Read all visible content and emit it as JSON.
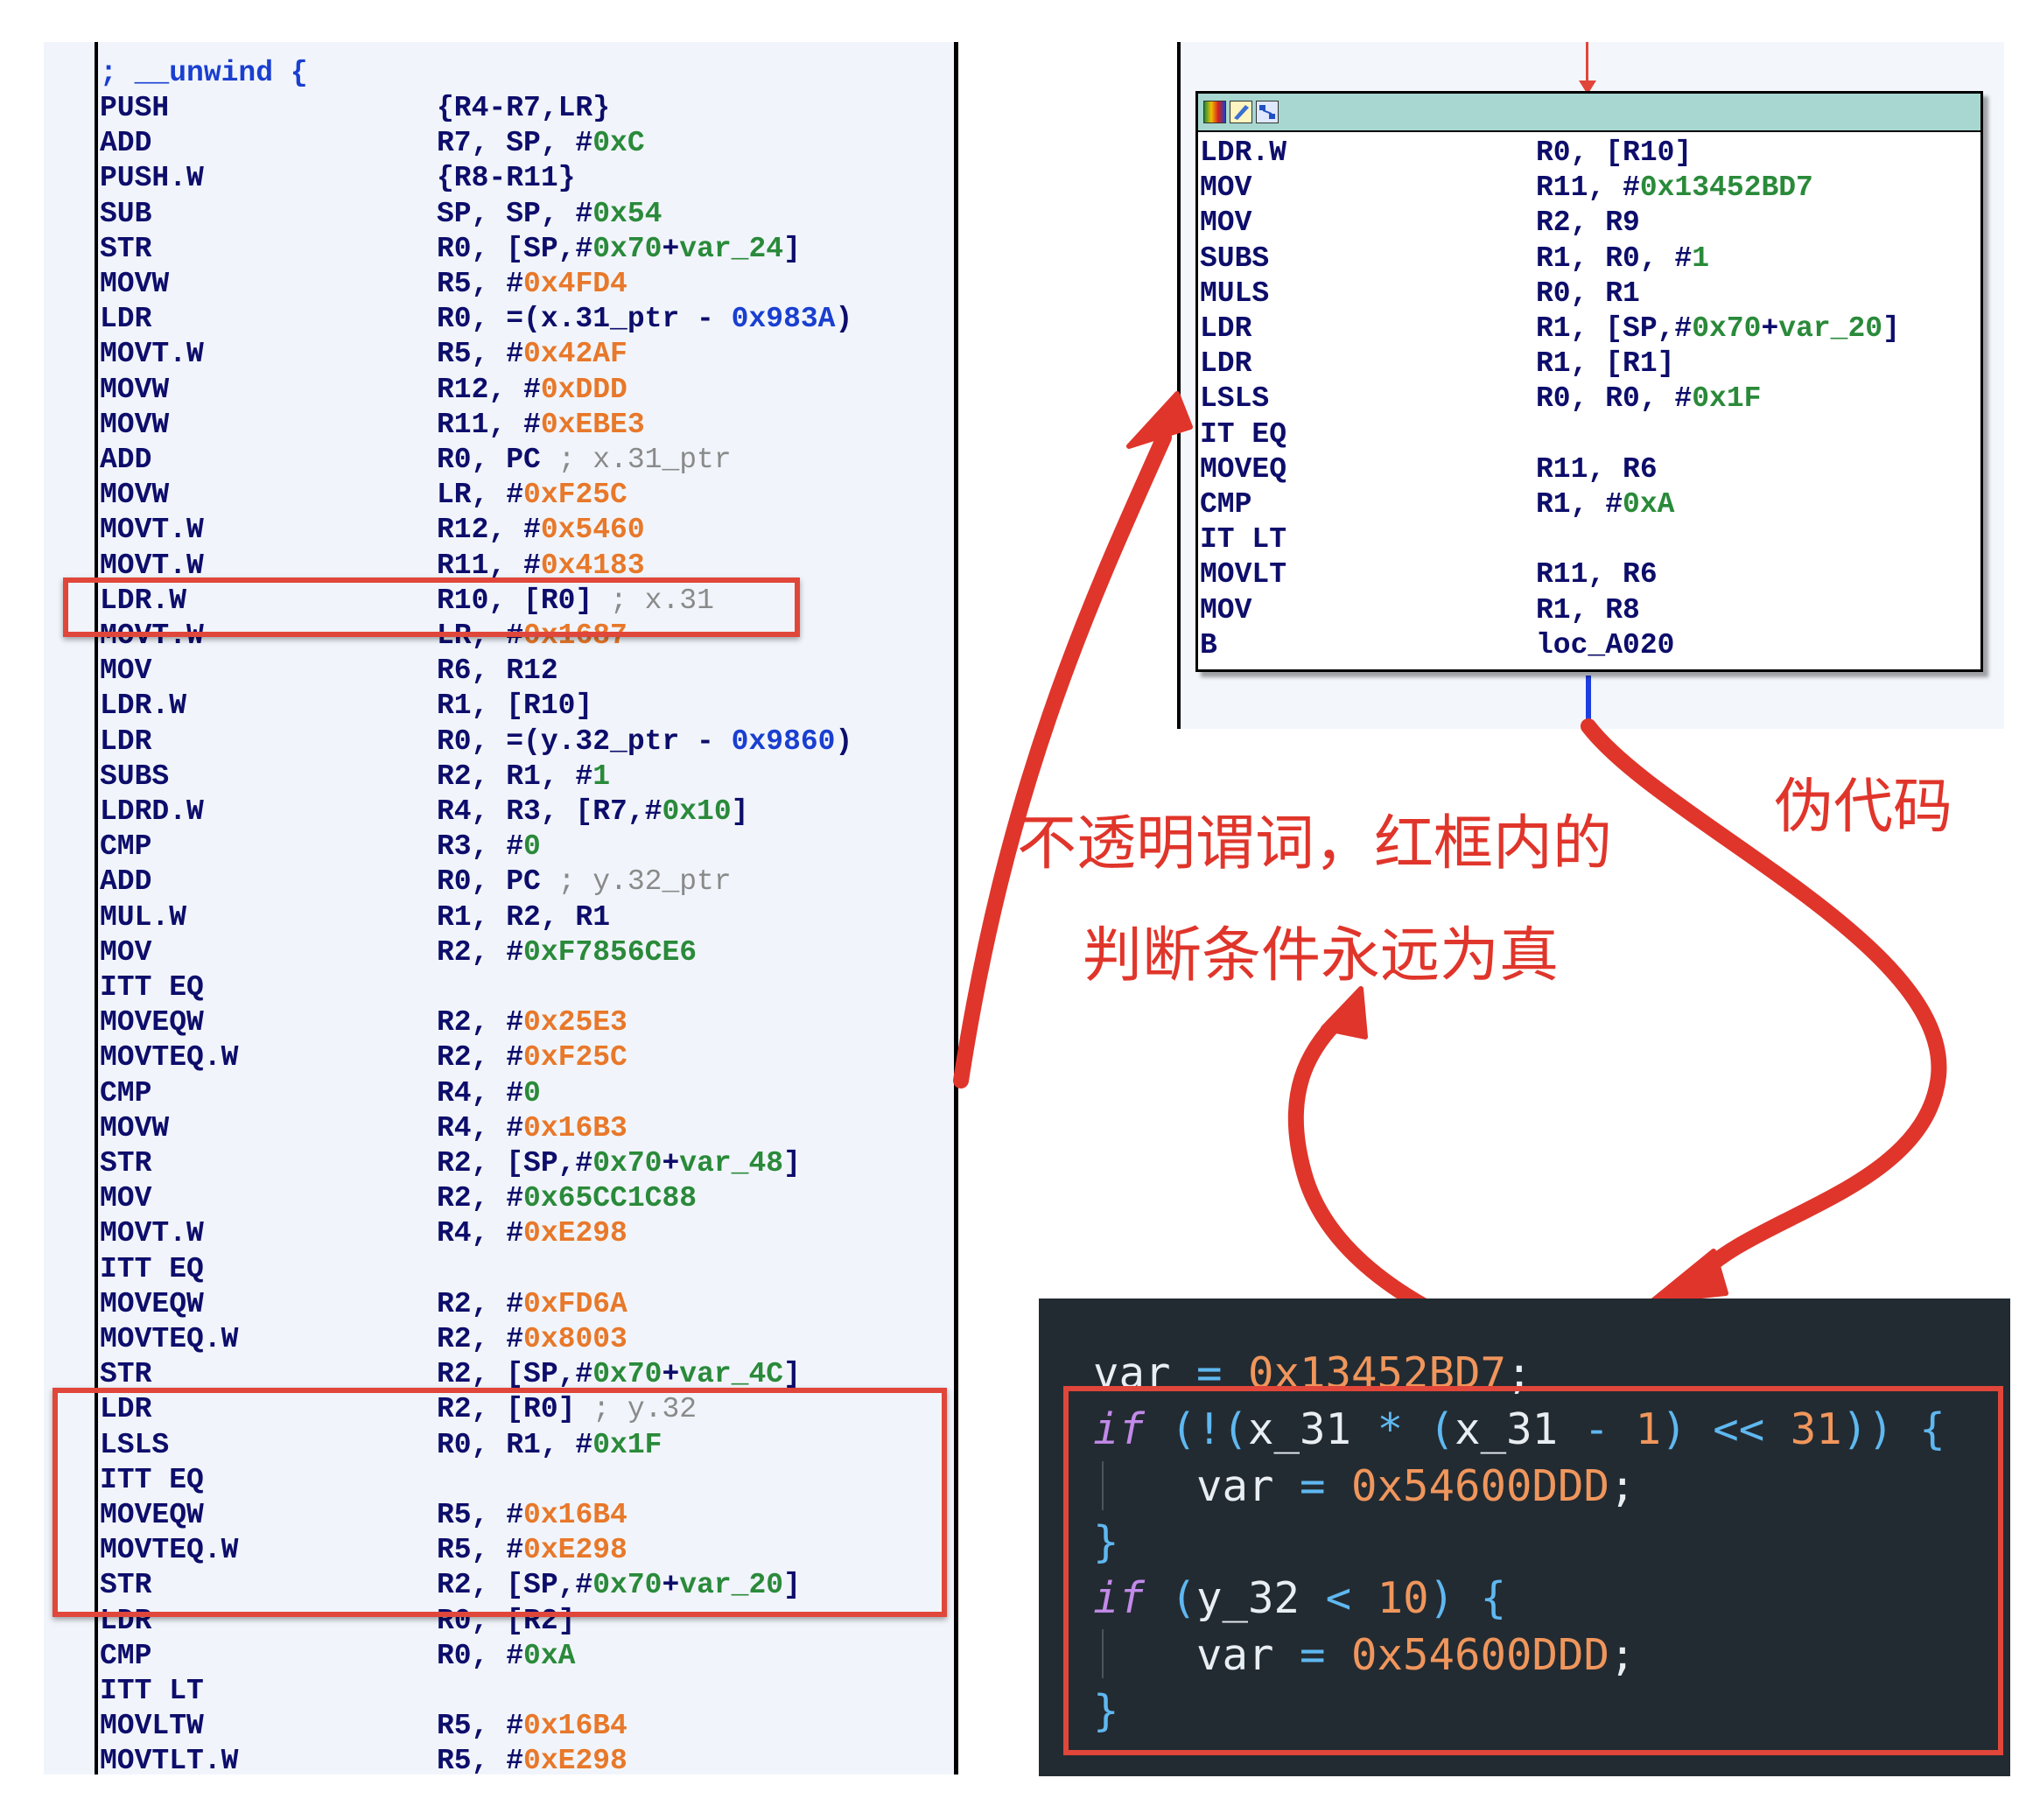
{
  "left_listing": {
    "header": "; __unwind {",
    "rows": [
      {
        "mn": "PUSH",
        "op": [
          {
            "t": "{R4-R7,LR}"
          }
        ]
      },
      {
        "mn": "ADD",
        "op": [
          {
            "t": "R7, SP, #"
          },
          {
            "t": "0xC",
            "c": "gn"
          }
        ]
      },
      {
        "mn": "PUSH.W",
        "op": [
          {
            "t": "{R8-R11}"
          }
        ]
      },
      {
        "mn": "SUB",
        "op": [
          {
            "t": "SP, SP, #"
          },
          {
            "t": "0x54",
            "c": "gn"
          }
        ]
      },
      {
        "mn": "STR",
        "op": [
          {
            "t": "R0, [SP,#"
          },
          {
            "t": "0x70",
            "c": "gn"
          },
          {
            "t": "+"
          },
          {
            "t": "var_24",
            "c": "gn"
          },
          {
            "t": "]"
          }
        ]
      },
      {
        "mn": "MOVW",
        "op": [
          {
            "t": "R5, #"
          },
          {
            "t": "0x4FD4",
            "c": "hx"
          }
        ]
      },
      {
        "mn": "LDR",
        "op": [
          {
            "t": "R0, =(x.31_ptr - "
          },
          {
            "t": "0x983A",
            "c": "bl"
          },
          {
            "t": ")"
          }
        ]
      },
      {
        "mn": "MOVT.W",
        "op": [
          {
            "t": "R5, #"
          },
          {
            "t": "0x42AF",
            "c": "hx"
          }
        ]
      },
      {
        "mn": "MOVW",
        "op": [
          {
            "t": "R12, #"
          },
          {
            "t": "0xDDD",
            "c": "hx"
          }
        ]
      },
      {
        "mn": "MOVW",
        "op": [
          {
            "t": "R11, #"
          },
          {
            "t": "0xEBE3",
            "c": "hx"
          }
        ]
      },
      {
        "mn": "ADD",
        "op": [
          {
            "t": "R0, PC  "
          },
          {
            "t": "; x.31_ptr",
            "c": "cm"
          }
        ]
      },
      {
        "mn": "MOVW",
        "op": [
          {
            "t": "LR, #"
          },
          {
            "t": "0xF25C",
            "c": "hx"
          }
        ]
      },
      {
        "mn": "MOVT.W",
        "op": [
          {
            "t": "R12, #"
          },
          {
            "t": "0x5460",
            "c": "hx"
          }
        ]
      },
      {
        "mn": "MOVT.W",
        "op": [
          {
            "t": "R11, #"
          },
          {
            "t": "0x4183",
            "c": "hx"
          }
        ]
      },
      {
        "mn": "LDR.W",
        "op": [
          {
            "t": "R10, [R0] "
          },
          {
            "t": "; x.31",
            "c": "cm"
          }
        ]
      },
      {
        "mn": "MOVT.W",
        "op": [
          {
            "t": "LR, #"
          },
          {
            "t": "0x1687",
            "c": "hx"
          }
        ]
      },
      {
        "mn": "MOV",
        "op": [
          {
            "t": "R6, R12"
          }
        ]
      },
      {
        "mn": "LDR.W",
        "op": [
          {
            "t": "R1, [R10]"
          }
        ]
      },
      {
        "mn": "LDR",
        "op": [
          {
            "t": "R0, =(y.32_ptr - "
          },
          {
            "t": "0x9860",
            "c": "bl"
          },
          {
            "t": ")"
          }
        ]
      },
      {
        "mn": "SUBS",
        "op": [
          {
            "t": "R2, R1, #"
          },
          {
            "t": "1",
            "c": "gn"
          }
        ]
      },
      {
        "mn": "LDRD.W",
        "op": [
          {
            "t": "R4, R3, [R7,#"
          },
          {
            "t": "0x10",
            "c": "gn"
          },
          {
            "t": "]"
          }
        ]
      },
      {
        "mn": "CMP",
        "op": [
          {
            "t": "R3, #"
          },
          {
            "t": "0",
            "c": "gn"
          }
        ]
      },
      {
        "mn": "ADD",
        "op": [
          {
            "t": "R0, PC  "
          },
          {
            "t": "; y.32_ptr",
            "c": "cm"
          }
        ]
      },
      {
        "mn": "MUL.W",
        "op": [
          {
            "t": "R1, R2, R1"
          }
        ]
      },
      {
        "mn": "MOV",
        "op": [
          {
            "t": "R2, #"
          },
          {
            "t": "0xF7856CE6",
            "c": "gn"
          }
        ]
      },
      {
        "mn": "ITT EQ",
        "op": []
      },
      {
        "mn": "MOVEQW",
        "op": [
          {
            "t": "R2, #"
          },
          {
            "t": "0x25E3",
            "c": "hx"
          }
        ]
      },
      {
        "mn": "MOVTEQ.W",
        "op": [
          {
            "t": "R2, #"
          },
          {
            "t": "0xF25C",
            "c": "hx"
          }
        ]
      },
      {
        "mn": "CMP",
        "op": [
          {
            "t": "R4, #"
          },
          {
            "t": "0",
            "c": "gn"
          }
        ]
      },
      {
        "mn": "MOVW",
        "op": [
          {
            "t": "R4, #"
          },
          {
            "t": "0x16B3",
            "c": "hx"
          }
        ]
      },
      {
        "mn": "STR",
        "op": [
          {
            "t": "R2, [SP,#"
          },
          {
            "t": "0x70",
            "c": "gn"
          },
          {
            "t": "+"
          },
          {
            "t": "var_48",
            "c": "gn"
          },
          {
            "t": "]"
          }
        ]
      },
      {
        "mn": "MOV",
        "op": [
          {
            "t": "R2, #"
          },
          {
            "t": "0x65CC1C88",
            "c": "gn"
          }
        ]
      },
      {
        "mn": "MOVT.W",
        "op": [
          {
            "t": "R4, #"
          },
          {
            "t": "0xE298",
            "c": "hx"
          }
        ]
      },
      {
        "mn": "ITT EQ",
        "op": []
      },
      {
        "mn": "MOVEQW",
        "op": [
          {
            "t": "R2, #"
          },
          {
            "t": "0xFD6A",
            "c": "hx"
          }
        ]
      },
      {
        "mn": "MOVTEQ.W",
        "op": [
          {
            "t": "R2, #"
          },
          {
            "t": "0x8003",
            "c": "hx"
          }
        ]
      },
      {
        "mn": "STR",
        "op": [
          {
            "t": "R2, [SP,#"
          },
          {
            "t": "0x70",
            "c": "gn"
          },
          {
            "t": "+"
          },
          {
            "t": "var_4C",
            "c": "gn"
          },
          {
            "t": "]"
          }
        ]
      },
      {
        "mn": "LDR",
        "op": [
          {
            "t": "R2, [R0] "
          },
          {
            "t": "; y.32",
            "c": "cm"
          }
        ]
      },
      {
        "mn": "LSLS",
        "op": [
          {
            "t": "R0, R1, #"
          },
          {
            "t": "0x1F",
            "c": "gn"
          }
        ]
      },
      {
        "mn": "ITT EQ",
        "op": []
      },
      {
        "mn": "MOVEQW",
        "op": [
          {
            "t": "R5, #"
          },
          {
            "t": "0x16B4",
            "c": "hx"
          }
        ]
      },
      {
        "mn": "MOVTEQ.W",
        "op": [
          {
            "t": "R5, #"
          },
          {
            "t": "0xE298",
            "c": "hx"
          }
        ]
      },
      {
        "mn": "STR",
        "op": [
          {
            "t": "R2, [SP,#"
          },
          {
            "t": "0x70",
            "c": "gn"
          },
          {
            "t": "+"
          },
          {
            "t": "var_20",
            "c": "gn"
          },
          {
            "t": "]"
          }
        ]
      },
      {
        "mn": "LDR",
        "op": [
          {
            "t": "R0, [R2]"
          }
        ]
      },
      {
        "mn": "CMP",
        "op": [
          {
            "t": "R0, #"
          },
          {
            "t": "0xA",
            "c": "gn"
          }
        ]
      },
      {
        "mn": "ITT LT",
        "op": []
      },
      {
        "mn": "MOVLTW",
        "op": [
          {
            "t": "R5, #"
          },
          {
            "t": "0x16B4",
            "c": "hx"
          }
        ]
      },
      {
        "mn": "MOVTLT.W",
        "op": [
          {
            "t": "R5, #"
          },
          {
            "t": "0xE298",
            "c": "hx"
          }
        ]
      }
    ]
  },
  "graph_node": {
    "rows": [
      {
        "mn": "LDR.W",
        "op": [
          {
            "t": "R0, [R10]"
          }
        ]
      },
      {
        "mn": "MOV",
        "op": [
          {
            "t": "R11, #"
          },
          {
            "t": "0x13452BD7",
            "c": "gn"
          }
        ]
      },
      {
        "mn": "MOV",
        "op": [
          {
            "t": "R2, R9"
          }
        ]
      },
      {
        "mn": "SUBS",
        "op": [
          {
            "t": "R1, R0, #"
          },
          {
            "t": "1",
            "c": "gn"
          }
        ]
      },
      {
        "mn": "MULS",
        "op": [
          {
            "t": "R0, R1"
          }
        ]
      },
      {
        "mn": "LDR",
        "op": [
          {
            "t": "R1, [SP,#"
          },
          {
            "t": "0x70",
            "c": "gn"
          },
          {
            "t": "+"
          },
          {
            "t": "var_20",
            "c": "gn"
          },
          {
            "t": "]"
          }
        ]
      },
      {
        "mn": "LDR",
        "op": [
          {
            "t": "R1, [R1]"
          }
        ]
      },
      {
        "mn": "LSLS",
        "op": [
          {
            "t": "R0, R0, #"
          },
          {
            "t": "0x1F",
            "c": "gn"
          }
        ]
      },
      {
        "mn": "IT EQ",
        "op": []
      },
      {
        "mn": "MOVEQ",
        "op": [
          {
            "t": "R11, R6"
          }
        ]
      },
      {
        "mn": "CMP",
        "op": [
          {
            "t": "R1, #"
          },
          {
            "t": "0xA",
            "c": "gn"
          }
        ]
      },
      {
        "mn": "IT LT",
        "op": []
      },
      {
        "mn": "MOVLT",
        "op": [
          {
            "t": "R11, R6"
          }
        ]
      },
      {
        "mn": "MOV",
        "op": [
          {
            "t": "R1, R8"
          }
        ]
      },
      {
        "mn": "B",
        "op": [
          {
            "t": "loc_A020"
          }
        ]
      }
    ]
  },
  "annotations": {
    "opaque_line1": "不透明谓词，红框内的",
    "opaque_line2": "判断条件永远为真",
    "pseudocode_label": "伪代码"
  },
  "pseudocode": {
    "lines": [
      [
        {
          "t": "var "
        },
        {
          "t": "=",
          "c": "pop"
        },
        {
          "t": " "
        },
        {
          "t": "0x13452BD7",
          "c": "pnum"
        },
        {
          "t": ";"
        }
      ],
      [
        {
          "t": "if",
          "c": "pkw"
        },
        {
          "t": " "
        },
        {
          "t": "(!(",
          "c": "pbr"
        },
        {
          "t": "x_31 "
        },
        {
          "t": "*",
          "c": "pop"
        },
        {
          "t": " "
        },
        {
          "t": "(",
          "c": "pbr"
        },
        {
          "t": "x_31 "
        },
        {
          "t": "-",
          "c": "pop"
        },
        {
          "t": " "
        },
        {
          "t": "1",
          "c": "pnum"
        },
        {
          "t": ")",
          "c": "pbr"
        },
        {
          "t": " "
        },
        {
          "t": "<<",
          "c": "pop"
        },
        {
          "t": " "
        },
        {
          "t": "31",
          "c": "pnum"
        },
        {
          "t": "))",
          "c": "pbr"
        },
        {
          "t": " "
        },
        {
          "t": "{",
          "c": "pbr"
        }
      ],
      [
        {
          "t": "    var "
        },
        {
          "t": "=",
          "c": "pop"
        },
        {
          "t": " "
        },
        {
          "t": "0x54600DDD",
          "c": "pnum"
        },
        {
          "t": ";"
        }
      ],
      [
        {
          "t": "}",
          "c": "pbr"
        }
      ],
      [
        {
          "t": "if",
          "c": "pkw"
        },
        {
          "t": " "
        },
        {
          "t": "(",
          "c": "pbr"
        },
        {
          "t": "y_32 "
        },
        {
          "t": "<",
          "c": "pop"
        },
        {
          "t": " "
        },
        {
          "t": "10",
          "c": "pnum"
        },
        {
          "t": ")",
          "c": "pbr"
        },
        {
          "t": " "
        },
        {
          "t": "{",
          "c": "pbr"
        }
      ],
      [
        {
          "t": "    var "
        },
        {
          "t": "=",
          "c": "pop"
        },
        {
          "t": " "
        },
        {
          "t": "0x54600DDD",
          "c": "pnum"
        },
        {
          "t": ";"
        }
      ],
      [
        {
          "t": "}",
          "c": "pbr"
        }
      ]
    ]
  },
  "colors": {
    "annotation_red": "#e0352b",
    "ida_mnemonic": "#0d0d6b",
    "ida_hex_orange": "#e8782a",
    "ida_green": "#2a8a3a",
    "pseudo_bg": "#232b32"
  }
}
